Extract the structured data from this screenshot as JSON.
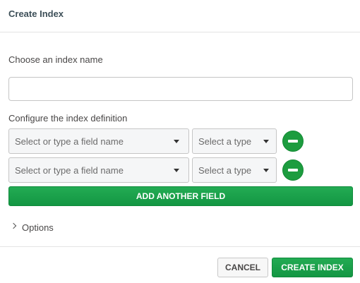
{
  "modal": {
    "title": "Create Index"
  },
  "index_name": {
    "label": "Choose an index name",
    "value": "",
    "placeholder": ""
  },
  "definition": {
    "label": "Configure the index definition",
    "rows": [
      {
        "field_placeholder": "Select or type a field name",
        "type_placeholder": "Select a type"
      },
      {
        "field_placeholder": "Select or type a field name",
        "type_placeholder": "Select a type"
      }
    ],
    "add_field_label": "ADD ANOTHER FIELD"
  },
  "options": {
    "label": "Options"
  },
  "footer": {
    "cancel_label": "CANCEL",
    "create_label": "CREATE INDEX"
  },
  "icons": {
    "remove": "minus-circle-icon",
    "caret": "caret-down-icon",
    "chevron": "chevron-right-icon"
  },
  "colors": {
    "accent_green": "#1aa14a",
    "title_text": "#3d4f58"
  }
}
